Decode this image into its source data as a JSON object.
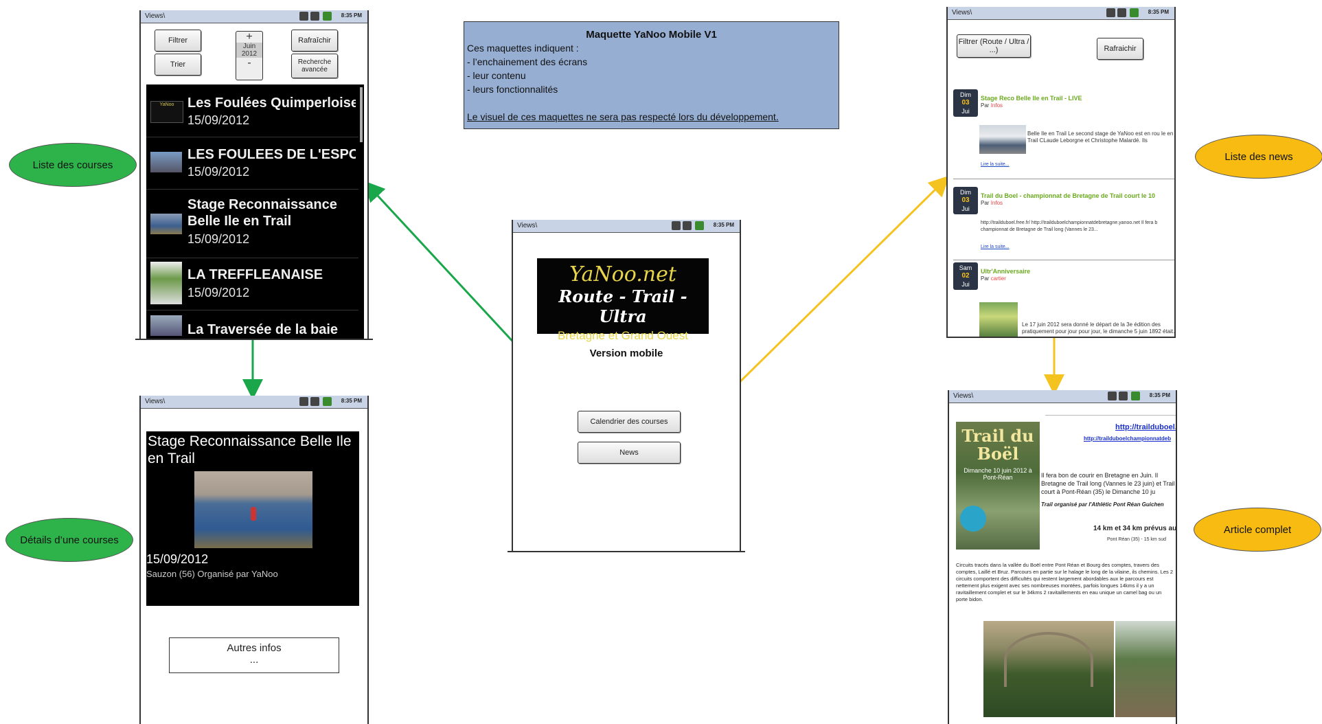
{
  "status_bar": {
    "views_label": "Views\\",
    "time": "8:35 PM"
  },
  "info_box": {
    "title": "Maquette YaNoo Mobile V1",
    "lines": [
      "Ces maquettes indiquent :",
      "- l’enchainement des écrans",
      "- leur contenu",
      "- leurs fonctionnalités"
    ],
    "note": "Le visuel de ces maquettes ne sera pas respecté lors du développement."
  },
  "labels": {
    "list_courses": "Liste des courses",
    "details": "Détails d’une courses",
    "list_news": "Liste des news",
    "full_article": "Article complet"
  },
  "courses_screen": {
    "filter": "Filtrer",
    "sort": "Trier",
    "refresh": "Rafraîchir",
    "advanced_search": "Recherche avancée",
    "plus": "+",
    "minus": "-",
    "month": "Juin",
    "year": "2012",
    "items": [
      {
        "title": "Les Foulées Quimperloises",
        "date": "15/09/2012"
      },
      {
        "title": "LES FOULEES DE L'ESPOIR",
        "date": "15/09/2012"
      },
      {
        "title": "Stage Reconnaissance",
        "title2": "Belle Ile en Trail",
        "date": "15/09/2012"
      },
      {
        "title": "LA TREFFLEANAISE",
        "date": "15/09/2012"
      },
      {
        "title": "La Traversée de la baie",
        "date": ""
      }
    ]
  },
  "detail_screen": {
    "title": "Stage Reconnaissance Belle Ile en Trail",
    "date": "15/09/2012",
    "location": "Sauzon (56) Organisé par YaNoo",
    "more_button": "Autres infos",
    "more_dots": "..."
  },
  "home_screen": {
    "logo_line1": "YaNoo.net",
    "logo_line2": "Route - Trail - Ultra",
    "logo_line3": "Bretagne et Grand Ouest",
    "subtitle": "Version mobile",
    "calendar_button": "Calendrier des courses",
    "news_button": "News"
  },
  "news_screen": {
    "filter": "Filtrer (Route / Ultra / ...)",
    "refresh": "Rafraichir",
    "by": "Par",
    "items": [
      {
        "day": "Dim",
        "num": "03",
        "month": "Jui",
        "title": "Stage Reco Belle Ile en Trail - LIVE",
        "cat": "Infos",
        "text": "Belle Ile en Trail Le second stage de YaNoo est en rou le en Trail CLaude Leborgne et Christophe Malardé. Ils",
        "link": "Lire la suite..."
      },
      {
        "day": "Dim",
        "num": "03",
        "month": "Jui",
        "title": "Trail du Boel - championnat de Bretagne de Trail court le 10",
        "cat": "Infos",
        "text": "http://trailduboel.free.fr/ http://trailduboelchampionnatdebretagne.yanoo.net     Il fera b championnat de Bretagne de Trail long (Vannes le 23...",
        "link": "Lire la suite..."
      },
      {
        "day": "Sam",
        "num": "02",
        "month": "Jui",
        "title": "Ultr'Anniversaire",
        "cat": "cartier",
        "text": "Le 17 juin 2012 sera donné le départ de la 3e édition des pratiquement pour jour pour jour, le dimanche 5 juin 1892 était...",
        "link": ""
      }
    ]
  },
  "article_screen": {
    "link1": "http://trailduboel.fr",
    "link2": "http://trailduboelchampionnatdeb",
    "poster_title": "Trail du Boël",
    "poster_sub": "Dimanche 10 juin 2012 à Pont-Réan",
    "intro": "Il fera bon de courir en Bretagne en Juin. Il Bretagne de Trail long (Vannes le 23 juin) et Trail court à Pont-Réan (35) le Dimanche 10 ju",
    "organizer": "Trail organisé par l'Athlétic Pont Réan Guichen",
    "distance": "14 km et 34 km prévus au",
    "location": "Pont Réan (35) - 15 km sud",
    "body": "Circuits tracés dans la vallée du Boël entre Pont Réan et Bourg des comptes, travers des comptes, Laillé et Bruz. Parcours en partie sur le halage le long de la vilaine, ils chemins. Les 2 circuits comportent des difficultés qui restent largement abordables aux le parcours est nettement plus exigent avec ses nombreuses montées, parfois longues 14kms il y a un ravitaillement complet et sur le 34kms 2 ravitaillements en eau unique un camel bag ou un porte bidon."
  },
  "colors": {
    "green": "#2db34a",
    "gold": "#f7bb12",
    "arrow_green": "#1aa64a",
    "arrow_gold": "#f5c320",
    "info_bg": "#97aed3"
  }
}
